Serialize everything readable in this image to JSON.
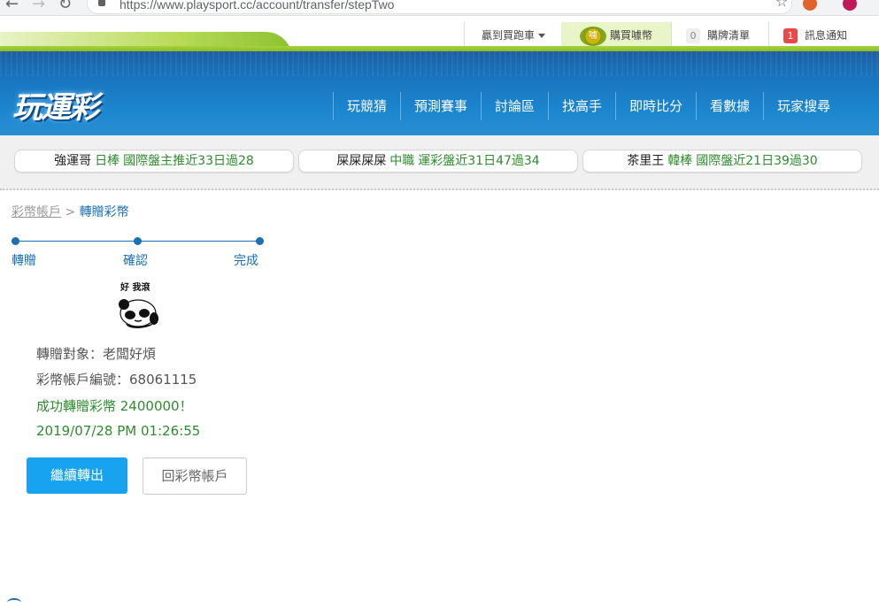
{
  "browser": {
    "url": "https://www.playsport.cc/account/transfer/stepTwo"
  },
  "topbar": {
    "cart_label": "贏到買跑車",
    "buy_label": "購買噱幣",
    "coin_glyph": "噱",
    "list_count": "0",
    "list_label": "購牌清單",
    "msg_count": "1",
    "msg_label": "訊息通知"
  },
  "header": {
    "logo": "玩運彩",
    "menu": [
      "玩競猜",
      "預測賽事",
      "討論區",
      "找高手",
      "即時比分",
      "看數據",
      "玩家搜尋"
    ]
  },
  "ticker": [
    {
      "name": "強運哥",
      "sport": "日棒",
      "record": "國際盤主推近33日過28"
    },
    {
      "name": "屎屎屎屎",
      "sport": "中職",
      "record": "運彩盤近31日47過34"
    },
    {
      "name": "茶里王",
      "sport": "韓棒",
      "record": "國際盤近21日39過30"
    }
  ],
  "breadcrumb": {
    "parent": "彩幣帳戶",
    "sep": ">",
    "current": "轉贈彩幣"
  },
  "steps": [
    "轉贈",
    "確認",
    "完成"
  ],
  "sticker_caption": "好 我滾",
  "result": {
    "target": "轉贈對象：老闆好煩",
    "account": "彩幣帳戶編號：68061115",
    "success": "成功轉贈彩幣 2400000！",
    "time": "2019/07/28 PM 01:26:55"
  },
  "buttons": {
    "continue": "繼續轉出",
    "back": "回彩幣帳戶"
  },
  "colors": {
    "accent": "#1a6fb5",
    "success": "#2e8b2e",
    "primary_button": "#18a3f0"
  }
}
